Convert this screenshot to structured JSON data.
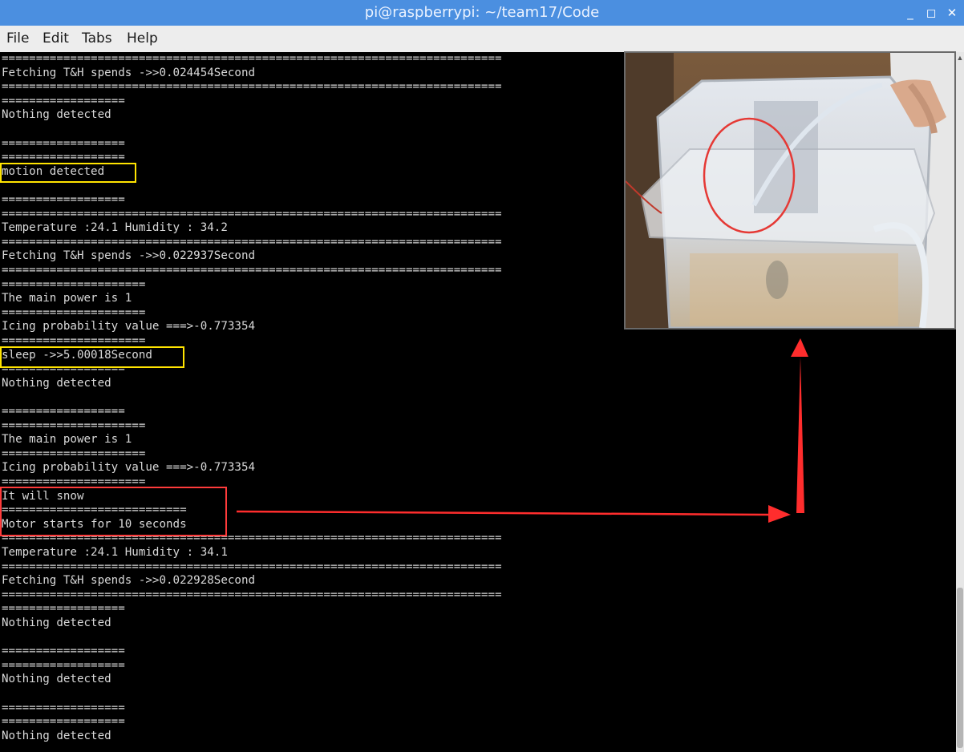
{
  "window": {
    "title": "pi@raspberrypi: ~/team17/Code"
  },
  "menu": {
    "items": [
      "File",
      "Edit",
      "Tabs",
      "Help"
    ]
  },
  "terminal": {
    "lines": [
      "=========================================================================",
      "Fetching T&H spends ->>0.024454Second",
      "=========================================================================",
      "==================",
      "Nothing detected",
      "",
      "==================",
      "==================",
      "motion detected",
      "",
      "==================",
      "=========================================================================",
      "Temperature :24.1 Humidity : 34.2",
      "=========================================================================",
      "Fetching T&H spends ->>0.022937Second",
      "=========================================================================",
      "=====================",
      "The main power is 1",
      "=====================",
      "Icing probability value ===>-0.773354",
      "=====================",
      "sleep ->>5.00018Second",
      "==================",
      "Nothing detected",
      "",
      "==================",
      "=====================",
      "The main power is 1",
      "=====================",
      "Icing probability value ===>-0.773354",
      "=====================",
      "It will snow",
      "===========================",
      "Motor starts for 10 seconds",
      "=========================================================================",
      "Temperature :24.1 Humidity : 34.1",
      "=========================================================================",
      "Fetching T&H spends ->>0.022928Second",
      "=========================================================================",
      "==================",
      "Nothing detected",
      "",
      "==================",
      "==================",
      "Nothing detected",
      "",
      "==================",
      "==================",
      "Nothing detected"
    ]
  },
  "colors": {
    "highlight_yellow": "#ffe400",
    "annotation_red": "#ff3b3b",
    "titlebar": "#4b8fe0"
  },
  "icons": [
    "minimize-icon",
    "maximize-icon",
    "close-icon",
    "scroll-up-arrow-icon"
  ]
}
